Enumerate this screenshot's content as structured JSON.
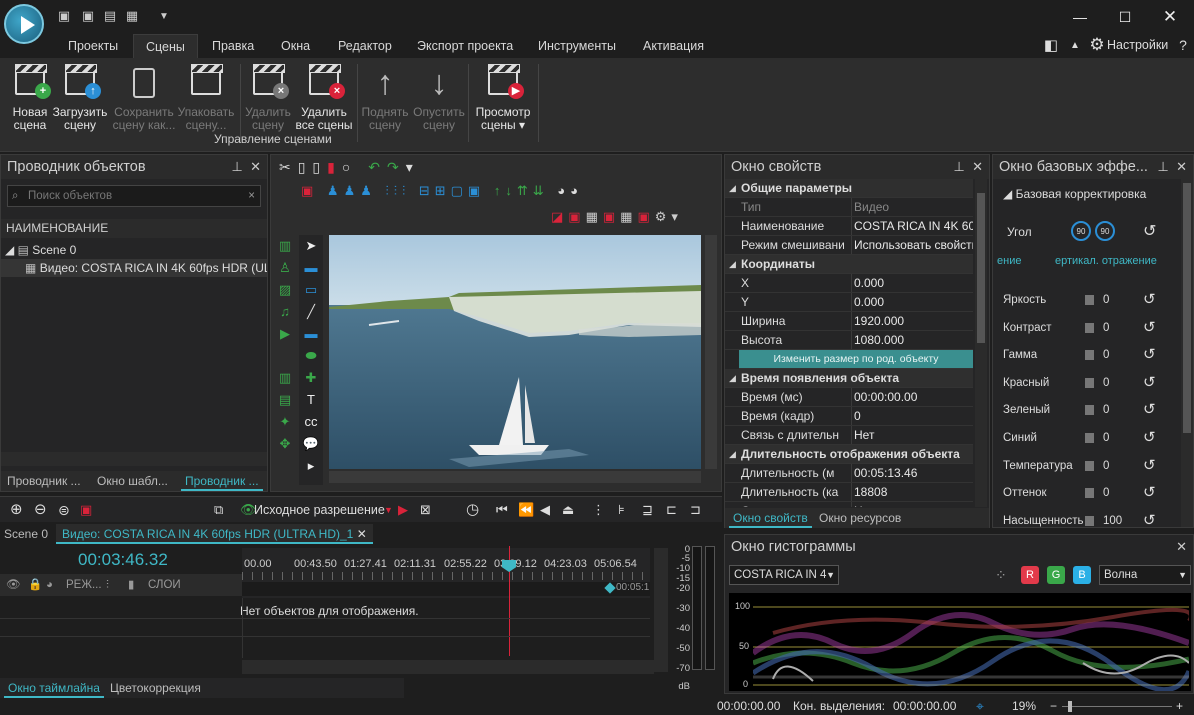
{
  "menu": {
    "items": [
      "Проекты",
      "Сцены",
      "Правка",
      "Окна",
      "Редактор",
      "Экспорт проекта",
      "Инструменты",
      "Активация"
    ],
    "active": 1,
    "settings": "Настройки"
  },
  "ribbon": {
    "buttons": [
      {
        "label": "Новая сцена",
        "enabled": true
      },
      {
        "label": "Загрузить сцену",
        "enabled": true
      },
      {
        "label": "Сохранить сцену как...",
        "enabled": false
      },
      {
        "label": "Упаковать сцену...",
        "enabled": false
      },
      {
        "label": "Удалить сцену",
        "enabled": false
      },
      {
        "label": "Удалить все сцены",
        "enabled": true
      },
      {
        "label": "Поднять сцену",
        "enabled": false
      },
      {
        "label": "Опустить сцену",
        "enabled": false
      },
      {
        "label": "Просмотр сцены",
        "enabled": true
      }
    ],
    "group_label": "Управление сценами"
  },
  "explorer": {
    "title": "Проводник объектов",
    "search_placeholder": "Поиск объектов",
    "column": "НАИМЕНОВАНИЕ",
    "scene": "Scene 0",
    "video": "Видео: COSTA RICA IN 4K 60fps HDR (ULTRA",
    "tabs": [
      "Проводник ...",
      "Окно шабл...",
      "Проводник ..."
    ]
  },
  "properties": {
    "title": "Окно свойств",
    "rows": [
      {
        "k": "Общие параметры",
        "v": "",
        "group": true
      },
      {
        "k": "Тип",
        "v": "Видео",
        "dim": true
      },
      {
        "k": "Наименование",
        "v": "COSTA RICA IN 4K 60fps"
      },
      {
        "k": "Режим смешивани",
        "v": "Использовать свойств"
      },
      {
        "k": "Координаты",
        "v": "",
        "group": true
      },
      {
        "k": "X",
        "v": "0.000"
      },
      {
        "k": "Y",
        "v": "0.000"
      },
      {
        "k": "Ширина",
        "v": "1920.000"
      },
      {
        "k": "Высота",
        "v": "1080.000"
      },
      {
        "k": "Изменить размер по род. объекту",
        "v": "",
        "button": true
      },
      {
        "k": "Время появления объекта",
        "v": "",
        "group": true
      },
      {
        "k": "Время (мс)",
        "v": "00:00:00.00"
      },
      {
        "k": "Время (кадр)",
        "v": "0"
      },
      {
        "k": "Связь с длительн",
        "v": "Нет"
      },
      {
        "k": "Длительность отображения объекта",
        "v": "",
        "group": true
      },
      {
        "k": "Длительность (м",
        "v": "00:05:13.46"
      },
      {
        "k": "Длительность (ка",
        "v": "18808"
      },
      {
        "k": "С",
        "v": "Н"
      }
    ],
    "tabs": [
      "Окно свойств",
      "Окно ресурсов"
    ]
  },
  "effects": {
    "title": "Окно базовых эффе...",
    "section": "Базовая корректировка",
    "angle_label": "Угол",
    "rot_left": "90",
    "rot_right": "90",
    "mirror_left": "ение",
    "mirror_right": "ертикал. отражение",
    "items": [
      {
        "label": "Яркость",
        "value": "0"
      },
      {
        "label": "Контраст",
        "value": "0"
      },
      {
        "label": "Гамма",
        "value": "0"
      },
      {
        "label": "Красный",
        "value": "0"
      },
      {
        "label": "Зеленый",
        "value": "0"
      },
      {
        "label": "Синий",
        "value": "0"
      },
      {
        "label": "Температура",
        "value": "0"
      },
      {
        "label": "Оттенок",
        "value": "0"
      },
      {
        "label": "Насыщенность",
        "value": "100"
      }
    ]
  },
  "histogram": {
    "title": "Окно гистограммы",
    "source": "COSTA RICA IN 4",
    "mode": "Волна",
    "ticks": [
      "100",
      "50",
      "0"
    ],
    "channels": [
      "R",
      "G",
      "B"
    ]
  },
  "timeline": {
    "resolution": "Исходное разрешение",
    "scene_tab": "Scene 0",
    "video_tab": "Видео: COSTA RICA IN 4K 60fps HDR (ULTRA HD)_1",
    "time": "00:03:46.32",
    "ruler": [
      "00.00",
      "00:43.50",
      "01:27.41",
      "02:11.31",
      "02:55.22",
      "03:39.12",
      "04:23.03",
      "05:06.54"
    ],
    "end_marker": "00:05:1",
    "cols": [
      "РЕЖ...",
      "СЛОИ"
    ],
    "empty": "Нет объектов для отображения.",
    "db": [
      "0",
      "-5",
      "-10",
      "-15",
      "-20",
      "-30",
      "-40",
      "-50",
      "-70",
      "dB"
    ],
    "bottom_tabs": [
      "Окно таймлайна",
      "Цветокоррекция"
    ]
  },
  "status": {
    "time": "00:00:00.00",
    "sel_label": "Кон. выделения:",
    "sel": "00:00:00.00",
    "zoom": "19%"
  }
}
